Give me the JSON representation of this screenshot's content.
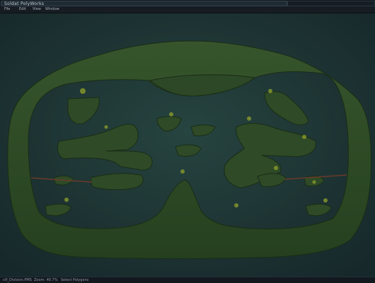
{
  "window": {
    "title": "Soldat PolyWorks"
  },
  "menu": {
    "items": [
      "File",
      "Edit",
      "View",
      "Window"
    ]
  },
  "status": {
    "filename": "ctf_Division.PMS",
    "zoom": "Zoom: 40.7%",
    "mode": "Select Polygons"
  },
  "colors": {
    "background": "#1d2f2d",
    "terrain": "#2f4a26",
    "terrain_edge": "#1a2c15",
    "bridge": "#6b3a2a",
    "scenery": "#8a9a2a"
  }
}
